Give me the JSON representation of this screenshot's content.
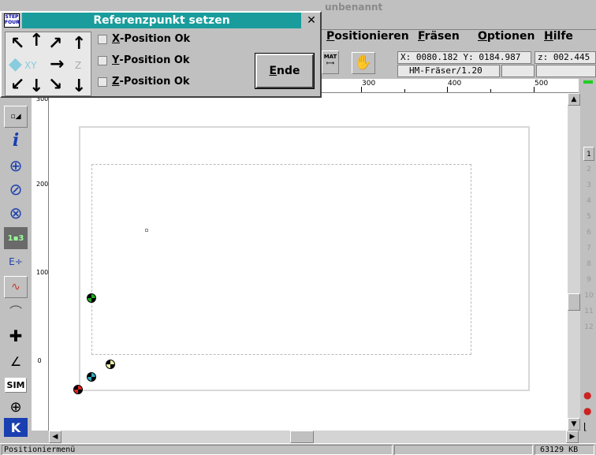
{
  "main_window": {
    "title": "unbenannt"
  },
  "menu": {
    "items": [
      {
        "label": "Positionieren",
        "u": "P",
        "rest": "ositionieren"
      },
      {
        "label": "Fräsen",
        "u": "F",
        "rest": "räsen"
      },
      {
        "label": "Optionen",
        "u": "O",
        "rest": "ptionen"
      },
      {
        "label": "Hilfe",
        "u": "H",
        "rest": "ilfe"
      }
    ]
  },
  "toolbar": {
    "mat_label": "MAT",
    "coords": "X: 0080.182 Y: 0184.987",
    "z_coord": "z: 002.445",
    "tool": "HM-Fräser/1.20"
  },
  "ruler": {
    "labels": [
      "300",
      "400",
      "500"
    ]
  },
  "left_ruler": {
    "labels": [
      "300",
      "200",
      "100",
      "0"
    ]
  },
  "page_buttons": [
    "1",
    "2",
    "3",
    "4",
    "5",
    "6",
    "7",
    "8",
    "9",
    "10",
    "11",
    "12"
  ],
  "dialog": {
    "title": "Referenzpunkt setzen",
    "logo": "STEP FOUR",
    "close": "✕",
    "pad_xy": "XY",
    "pad_z": "Z",
    "checks": [
      {
        "u": "X",
        "rest": "-Position Ok"
      },
      {
        "u": "Y",
        "rest": "-Position Ok"
      },
      {
        "u": "Z",
        "rest": "-Position Ok"
      }
    ],
    "ende": {
      "u": "E",
      "rest": "nde"
    }
  },
  "left_tools": {
    "sim_label": "SIM",
    "k_label": "K"
  },
  "statusbar": {
    "message": "Positioniermenü",
    "memory": "63129 KB"
  }
}
